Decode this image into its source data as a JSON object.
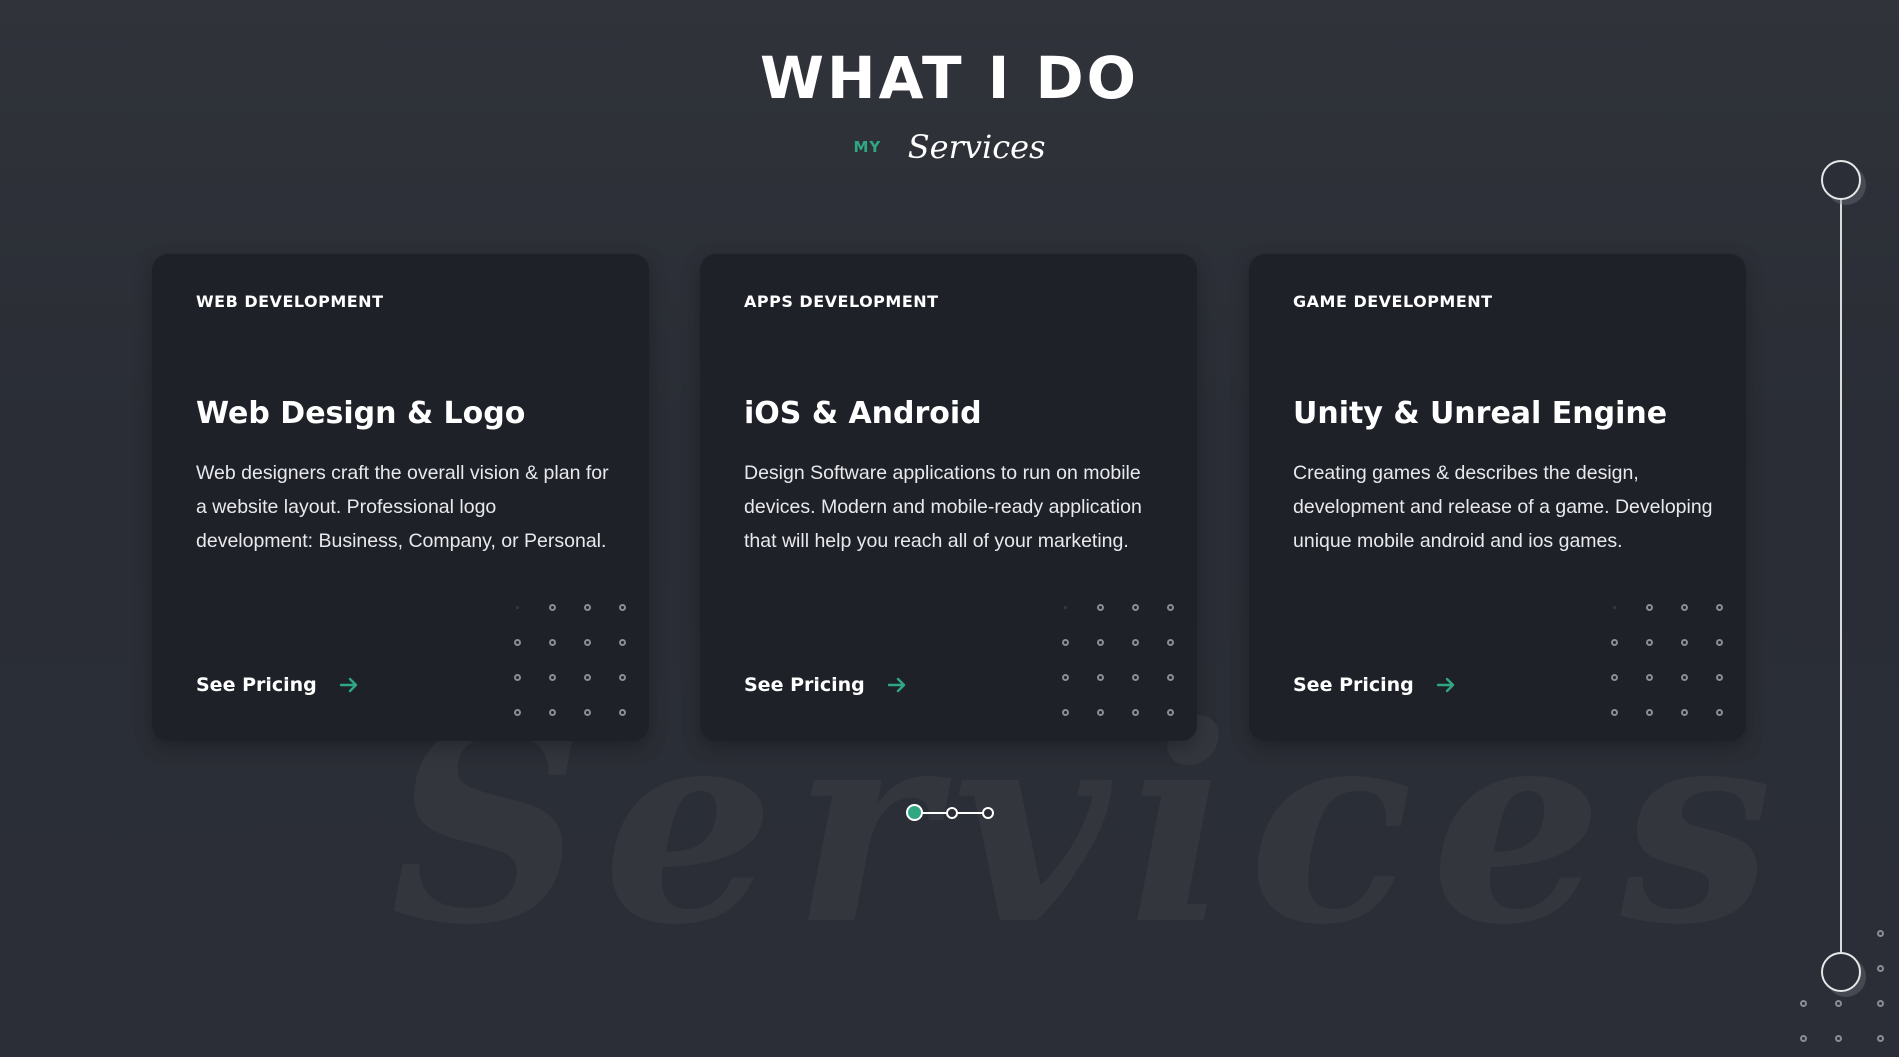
{
  "header": {
    "title": "WHAT I DO",
    "subtitle_prefix": "MY",
    "subtitle_script": "Services"
  },
  "watermark": "Services",
  "cards": [
    {
      "category": "WEB DEVELOPMENT",
      "title": "Web Design & Logo",
      "description": "Web designers craft the overall vision & plan for a website layout. Professional logo development: Business, Company, or Personal.",
      "link_label": "See Pricing",
      "link_icon": "arrow-right-icon"
    },
    {
      "category": "APPS DEVELOPMENT",
      "title": "iOS & Android",
      "description": "Design Software applications to run on mobile devices. Modern and mobile-ready application that will help you reach all of your marketing.",
      "link_label": "See Pricing",
      "link_icon": "arrow-right-icon"
    },
    {
      "category": "GAME DEVELOPMENT",
      "title": "Unity & Unreal Engine",
      "description": "Creating games & describes the design, development and release of a game. Developing unique mobile android and ios games.",
      "link_label": "See Pricing",
      "link_icon": "arrow-right-icon"
    }
  ],
  "pagination": {
    "pages": 3,
    "active_page": 1
  },
  "colors": {
    "accent": "#2fa783",
    "background": "#2b2e36",
    "card": "#1f2129",
    "text": "#ffffff"
  }
}
